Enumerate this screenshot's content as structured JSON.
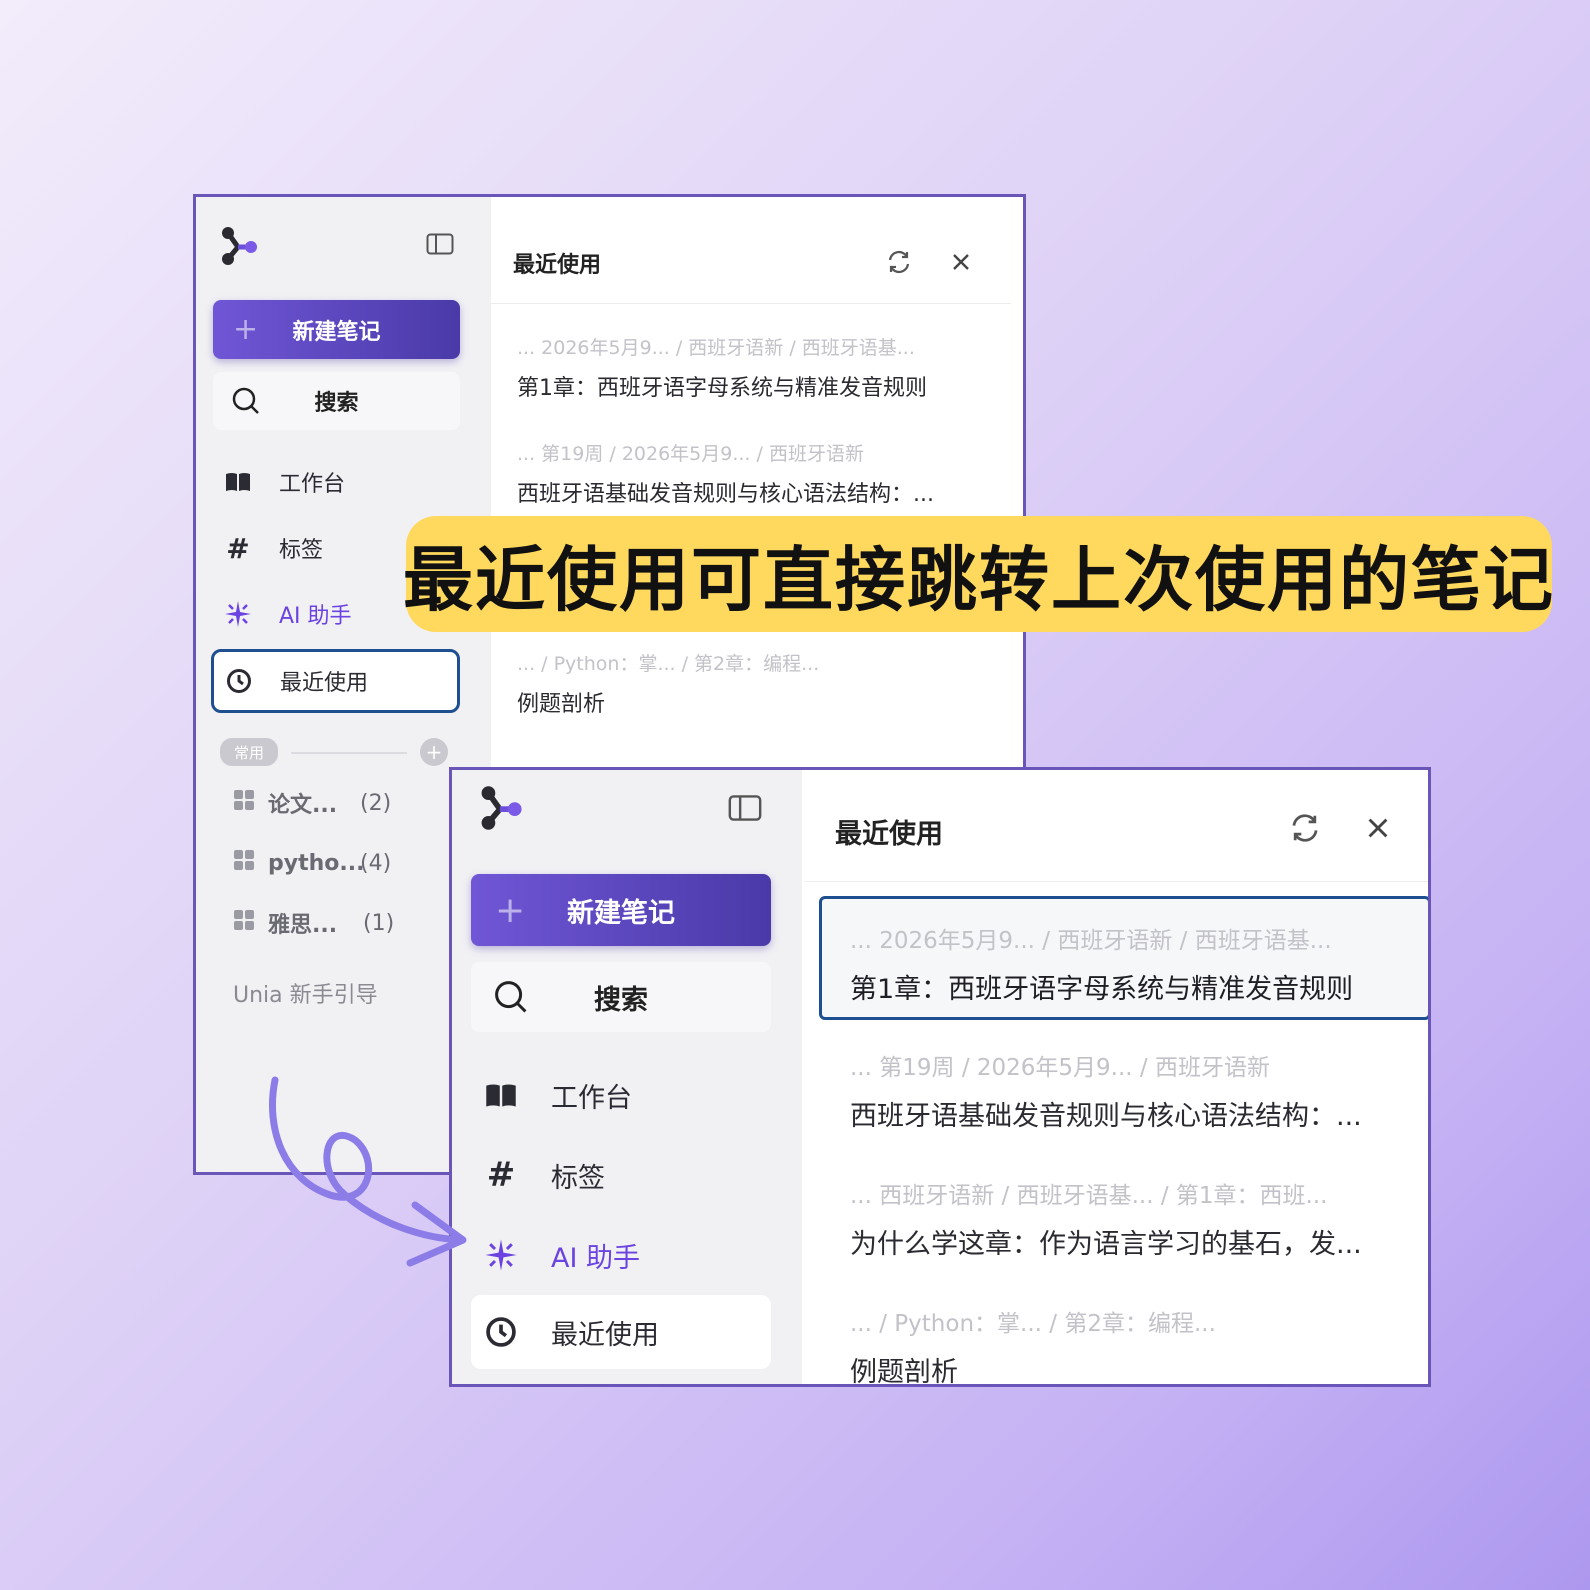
{
  "banner": {
    "text": "最近使用可直接跳转上次使用的笔记"
  },
  "sidebar": {
    "new_note": "新建笔记",
    "search": "搜索",
    "nav": {
      "workbench": "工作台",
      "tags": "标签",
      "ai": "AI 助手",
      "recent": "最近使用"
    },
    "group_label": "常用",
    "groups": [
      {
        "name": "论文...",
        "count": "(2)"
      },
      {
        "name": "pytho...",
        "count": "(4)"
      },
      {
        "name": "雅思...",
        "count": "(1)"
      }
    ],
    "guide": "Unia 新手引导"
  },
  "panel": {
    "title": "最近使用",
    "items": [
      {
        "path": "... 2026年5月9...  /  西班牙语新  /  西班牙语基...",
        "title": "第1章：西班牙语字母系统与精准发音规则"
      },
      {
        "path": "... 第19周  /  2026年5月9...  /  西班牙语新",
        "title": "西班牙语基础发音规则与核心语法结构：..."
      },
      {
        "path": "... 西班牙语新  /  西班牙语基...   /  第1章：西班...",
        "title": "为什么学这章：作为语言学习的基石，发..."
      },
      {
        "path": "...   /  Python：掌...   /  第2章：编程...",
        "title": "例题剖析"
      }
    ]
  },
  "colors": {
    "accent": "#6a43e0",
    "highlight": "#ffd95e",
    "selection_border": "#1d4f91"
  }
}
